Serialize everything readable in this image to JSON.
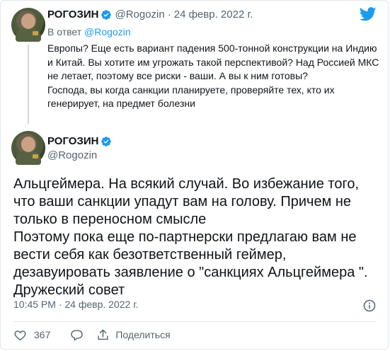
{
  "colors": {
    "verified": "#1d9bf0",
    "twitter_blue": "#1d9bf0",
    "like_red": "#f91880",
    "text": "#0f1419",
    "muted": "#536471"
  },
  "quoted_tweet": {
    "author_name": "РОГОЗИН",
    "handle": "@Rogozin",
    "separator": "·",
    "date": "24 февр. 2022 г.",
    "reply_prefix": "В ответ",
    "reply_handle": "@Rogozin",
    "paragraphs": [
      "Европы? Еще есть вариант падения 500-тонной конструкции на Индию и Китай. Вы хотите им угрожать такой перспективой? Над Россией МКС не летает, поэтому все риски - ваши. А вы к ним готовы?",
      "Господа, вы когда санкции планируете, проверяйте тех, кто их генерирует, на предмет болезни"
    ]
  },
  "main_tweet": {
    "author_name": "РОГОЗИН",
    "handle": "@Rogozin",
    "paragraphs": [
      "Альцгеймера. На всякий случай. Во избежание того, что ваши санкции упадут вам на голову. Причем не только в переносном смысле",
      "Поэтому пока еще по-партнерски предлагаю вам не вести себя как безответственный геймер, дезавуировать заявление о \"санкциях Альцгеймера \". Дружеский совет"
    ],
    "time": "10:45 PM",
    "separator": "·",
    "date": "24 февр. 2022 г."
  },
  "actions": {
    "like_count": "367",
    "share_label": "Поделиться"
  },
  "icons": [
    "twitter-bird-icon",
    "verified-badge-icon",
    "info-icon",
    "heart-icon",
    "reply-icon",
    "share-icon"
  ]
}
